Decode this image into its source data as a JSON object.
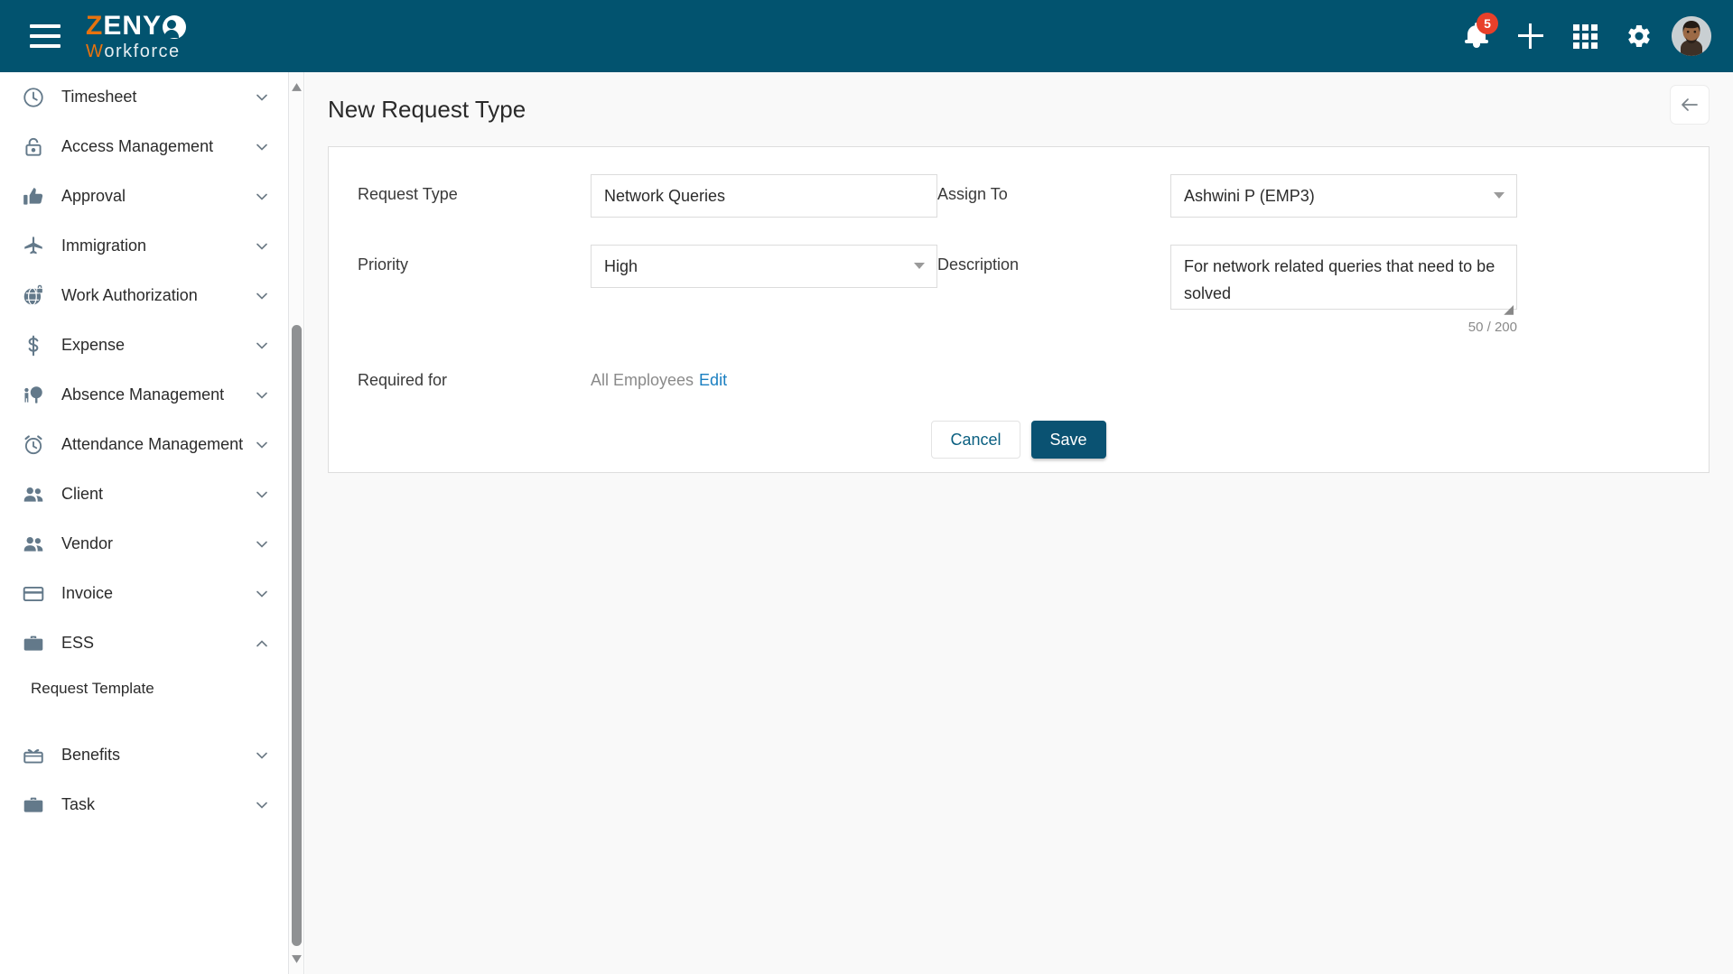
{
  "brand": {
    "z": "Z",
    "eny": "ENY",
    "w": "W",
    "orkforce": "orkforce"
  },
  "header": {
    "menu_icon": "hamburger-menu-icon",
    "notifications_badge": "5",
    "icons": [
      "bell-icon",
      "plus-icon",
      "apps-grid-icon",
      "gear-icon",
      "avatar"
    ]
  },
  "sidebar": {
    "items": [
      {
        "label": "Timesheet",
        "icon": "clock-icon",
        "chevron": "down"
      },
      {
        "label": "Access Management",
        "icon": "lock-icon",
        "chevron": "down"
      },
      {
        "label": "Approval",
        "icon": "thumbs-up-icon",
        "chevron": "down"
      },
      {
        "label": "Immigration",
        "icon": "airplane-icon",
        "chevron": "down"
      },
      {
        "label": "Work Authorization",
        "icon": "globe-lock-icon",
        "chevron": "down"
      },
      {
        "label": "Expense",
        "icon": "dollar-icon",
        "chevron": "down"
      },
      {
        "label": "Absence Management",
        "icon": "person-tree-icon",
        "chevron": "down"
      },
      {
        "label": "Attendance Management",
        "icon": "alarm-clock-icon",
        "chevron": "down"
      },
      {
        "label": "Client",
        "icon": "people-icon",
        "chevron": "down"
      },
      {
        "label": "Vendor",
        "icon": "people-icon",
        "chevron": "down"
      },
      {
        "label": "Invoice",
        "icon": "credit-card-icon",
        "chevron": "down"
      },
      {
        "label": "ESS",
        "icon": "briefcase-icon",
        "chevron": "up"
      }
    ],
    "sub_item": "Request Template",
    "items_after": [
      {
        "label": "Benefits",
        "icon": "gift-icon",
        "chevron": "down"
      },
      {
        "label": "Task",
        "icon": "briefcase-icon",
        "chevron": "down"
      }
    ]
  },
  "page": {
    "title": "New Request Type",
    "back_icon": "arrow-left-icon"
  },
  "form": {
    "request_type": {
      "label": "Request Type",
      "value": "Network Queries",
      "placeholder": ""
    },
    "assign_to": {
      "label": "Assign To",
      "value": "Ashwini P (EMP3)"
    },
    "priority": {
      "label": "Priority",
      "value": "High"
    },
    "description": {
      "label": "Description",
      "value": "For network related queries that need to be solved",
      "counter": "50 / 200"
    },
    "required_for": {
      "label": "Required for",
      "value": "All Employees",
      "edit_link": "Edit"
    },
    "buttons": {
      "cancel": "Cancel",
      "save": "Save"
    }
  },
  "colors": {
    "brand_teal": "#02536f",
    "brand_orange": "#e8730f",
    "save_button": "#0a5272",
    "link_blue": "#1a7fc1",
    "badge_red": "#e8402a"
  }
}
